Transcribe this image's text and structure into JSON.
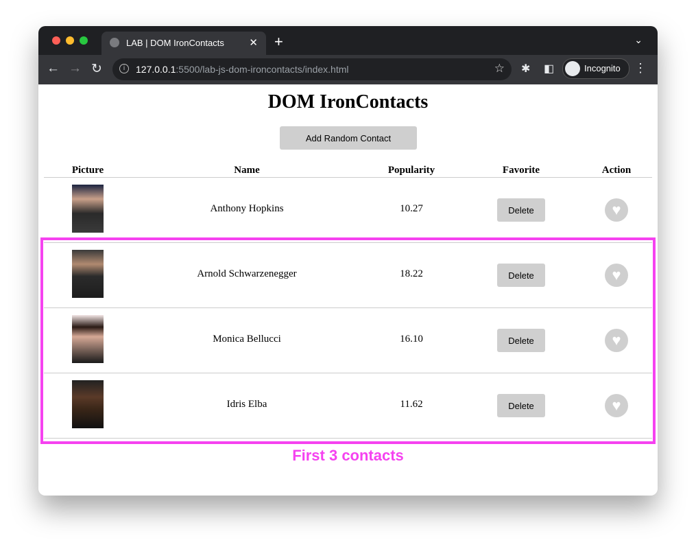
{
  "browser": {
    "tab_title": "LAB | DOM IronContacts",
    "url_host": "127.0.0.1",
    "url_rest": ":5500/lab-js-dom-ironcontacts/index.html",
    "profile": "Incognito"
  },
  "page": {
    "title": "DOM IronContacts",
    "add_button": "Add Random Contact",
    "headers": [
      "Picture",
      "Name",
      "Popularity",
      "Favorite",
      "Action"
    ],
    "contacts": [
      {
        "name": "Anthony Hopkins",
        "popularity": "10.27",
        "delete": "Delete"
      },
      {
        "name": "Arnold Schwarzenegger",
        "popularity": "18.22",
        "delete": "Delete"
      },
      {
        "name": "Monica Bellucci",
        "popularity": "16.10",
        "delete": "Delete"
      },
      {
        "name": "Idris Elba",
        "popularity": "11.62",
        "delete": "Delete"
      }
    ],
    "annotation": "First 3 contacts",
    "annotation_color": "#f542f0"
  }
}
